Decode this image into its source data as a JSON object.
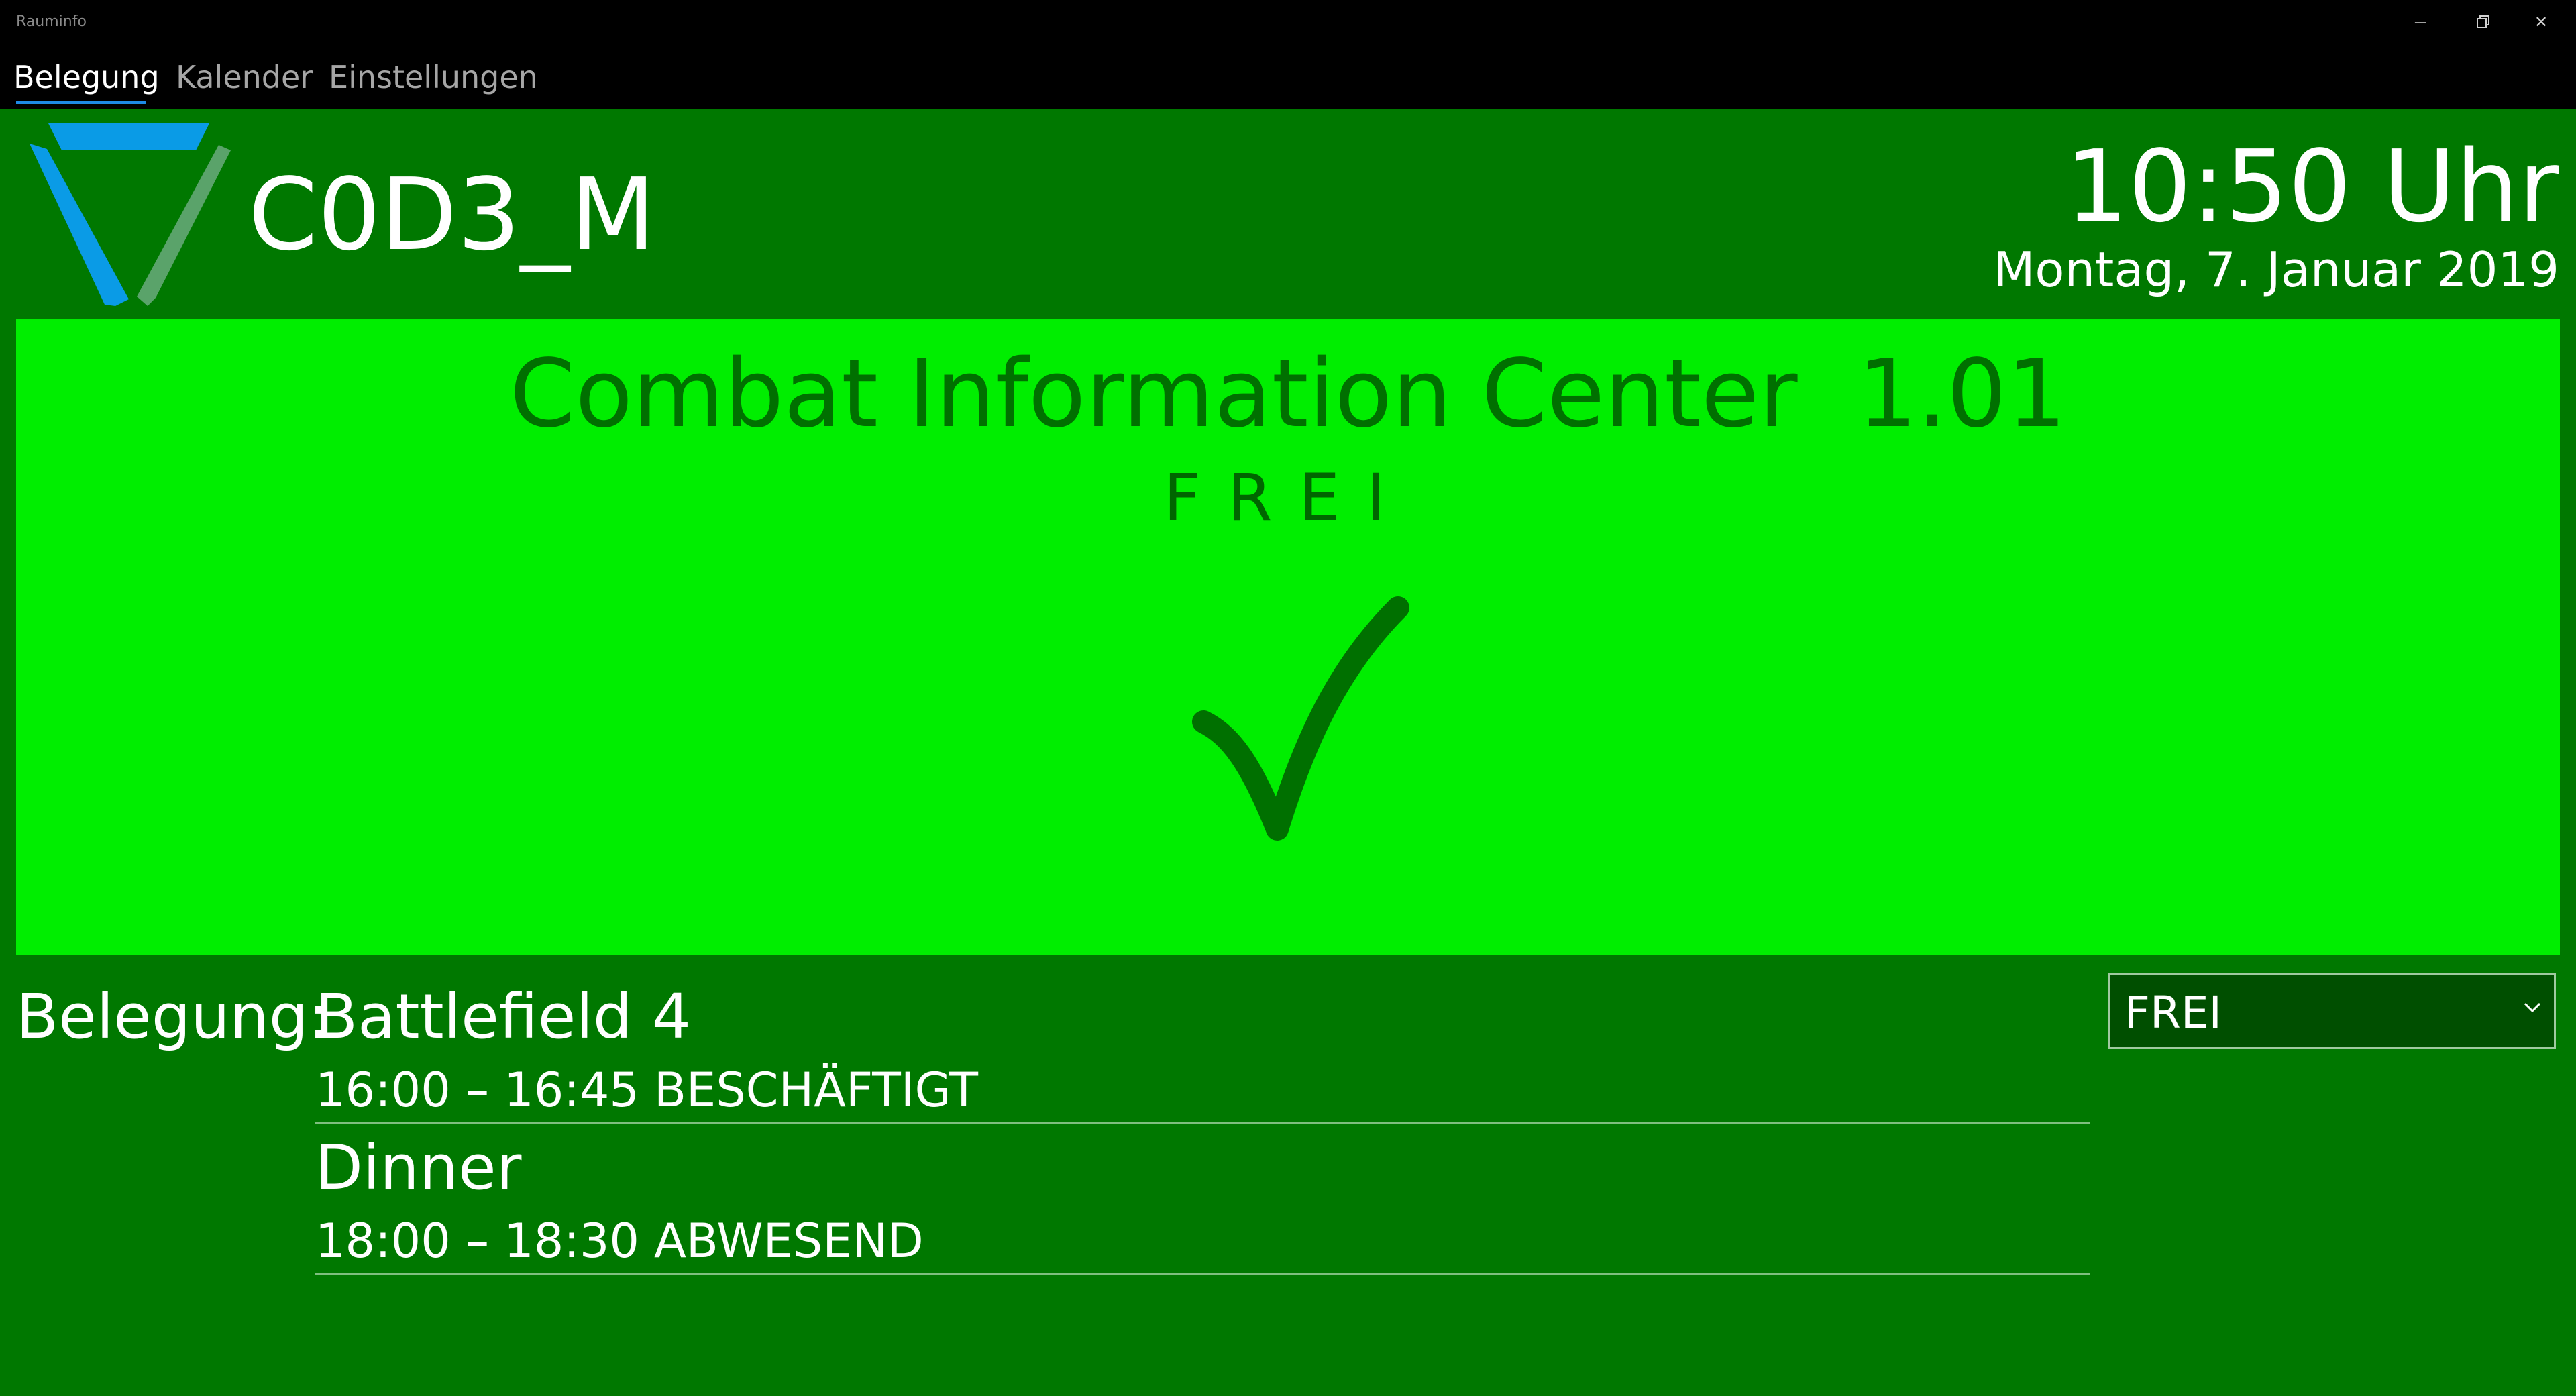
{
  "window": {
    "title": "Rauminfo",
    "minimize_glyph": "—",
    "close_glyph": "✕"
  },
  "nav": {
    "tabs": [
      {
        "label": "Belegung",
        "active": true
      },
      {
        "label": "Kalender",
        "active": false
      },
      {
        "label": "Einstellungen",
        "active": false
      }
    ]
  },
  "header": {
    "room_code": "C0D3_M",
    "time": "10:50 Uhr",
    "date": "Montag, 7. Januar 2019"
  },
  "status": {
    "room_name": "Combat Information Center  1.01",
    "state": "FREI",
    "icon": "checkmark-icon"
  },
  "occupancy": {
    "label": "Belegung:",
    "events": [
      {
        "title": "Battlefield 4",
        "time": "16:00 – 16:45",
        "state": "BESCHÄFTIGT"
      },
      {
        "title": "Dinner",
        "time": "18:00 – 18:30",
        "state": "ABWESEND"
      }
    ]
  },
  "status_select": {
    "value": "FREI"
  },
  "colors": {
    "background": "#007800",
    "panel_free": "#00ee00",
    "accent": "#1e8be6",
    "logo_blue": "#0a9be6",
    "logo_green": "#5aa36a"
  }
}
